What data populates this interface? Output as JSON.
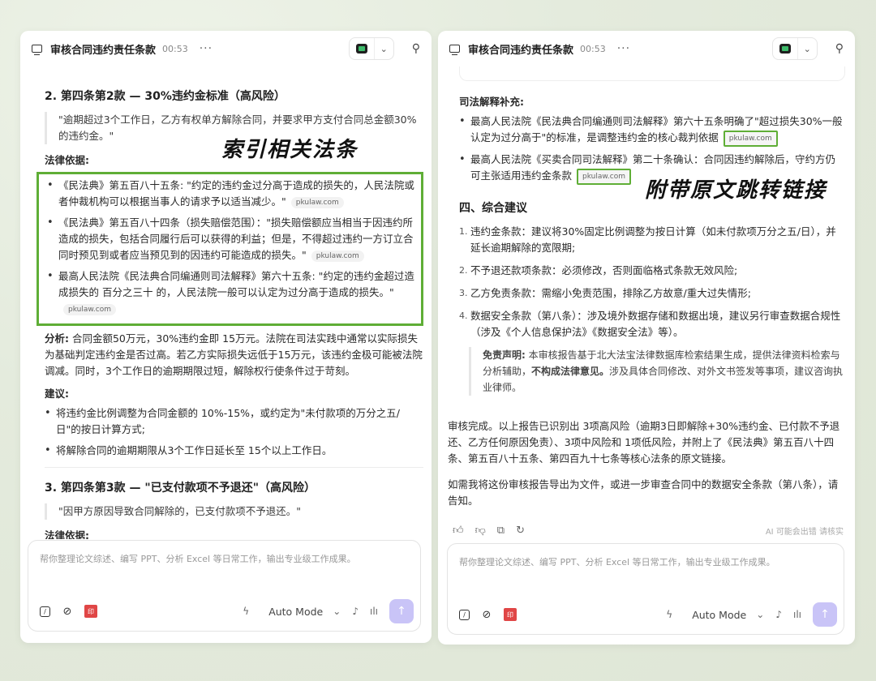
{
  "left": {
    "title": "审核合同违约责任条款",
    "time": "00:53",
    "more": "···",
    "section2": {
      "heading": "2. 第四条第2款 — 30%违约金标准（高风险）",
      "quote": "\"逾期超过3个工作日，乙方有权单方解除合同，并要求甲方支付合同总金额30% 的违约金。\"",
      "legal_label": "法律依据:",
      "legal_items": [
        {
          "text": "《民法典》第五百八十五条: \"约定的违约金过分高于造成的损失的，人民法院或者仲裁机构可以根据当事人的请求予以适当减少。\"",
          "tag": "pkulaw.com"
        },
        {
          "text": "《民法典》第五百八十四条（损失赔偿范围）：\"损失赔偿额应当相当于因违约所造成的损失，包括合同履行后可以获得的利益；但是，不得超过违约一方订立合同时预见到或者应当预见到的因违约可能造成的损失。\"",
          "tag": "pkulaw.com"
        },
        {
          "text": "最高人民法院《民法典合同编通则司法解释》第六十五条: \"约定的违约金超过造成损失的 百分之三十 的，人民法院一般可以认定为过分高于造成的损失。\"",
          "tag": "pkulaw.com"
        }
      ],
      "analysis_label": "分析:",
      "analysis_text": "合同金额50万元，30%违约金即 15万元。法院在司法实践中通常以实际损失为基础判定违约金是否过高。若乙方实际损失远低于15万元，该违约金极可能被法院调减。同时，3个工作日的逾期期限过短，解除权行使条件过于苛刻。",
      "suggest_label": "建议:",
      "suggestions": [
        "将违约金比例调整为合同金额的 10%-15%，或约定为\"未付款项的万分之五/日\"的按日计算方式;",
        "将解除合同的逾期期限从3个工作日延长至 15个以上工作日。"
      ]
    },
    "section3": {
      "heading": "3. 第四条第3款 — \"已支付款项不予退还\"（高风险）",
      "quote": "\"因甲方原因导致合同解除的，已支付款项不予退还。\"",
      "legal_label": "法律依据:"
    },
    "callout": "索引相关法条",
    "composer": {
      "placeholder": "帮你整理论文综述、编写 PPT、分析 Excel 等日常工作，输出专业级工作成果。",
      "mode": "Auto Mode"
    }
  },
  "right": {
    "title": "审核合同违约责任条款",
    "time": "00:53",
    "more": "···",
    "judicial_label": "司法解释补充:",
    "judicial_items": [
      {
        "text": "最高人民法院《民法典合同编通则司法解释》第六十五条明确了\"超过损失30%一般认定为过分高于\"的标准，是调整违约金的核心裁判依据",
        "tag": "pkulaw.com"
      },
      {
        "text": "最高人民法院《买卖合同司法解释》第二十条确认：合同因违约解除后，守约方仍可主张适用违约金条款",
        "tag": "pkulaw.com"
      }
    ],
    "callout": "附带原文跳转链接",
    "section4_heading": "四、综合建议",
    "recommendations": [
      {
        "n": "1.",
        "text": "违约金条款：建议将30%固定比例调整为按日计算（如未付款项万分之五/日），并延长逾期解除的宽限期;"
      },
      {
        "n": "2.",
        "text": "不予退还款项条款：必须修改，否则面临格式条款无效风险;"
      },
      {
        "n": "3.",
        "text": "乙方免责条款：需缩小免责范围，排除乙方故意/重大过失情形;"
      },
      {
        "n": "4.",
        "text": "数据安全条款（第八条）：涉及境外数据存储和数据出境，建议另行审查数据合规性（涉及《个人信息保护法》《数据安全法》等）。"
      }
    ],
    "disclaimer_label": "免责声明:",
    "disclaimer_text": "本审核报告基于北大法宝法律数据库检索结果生成，提供法律资料检索与分析辅助，",
    "disclaimer_bold": "不构成法律意见。",
    "disclaimer_tail": "涉及具体合同修改、对外文书签发等事项，建议咨询执业律师。",
    "summary_p1": "审核完成。以上报告已识别出 3项高风险（逾期3日即解除+30%违约金、已付款不予退还、乙方任何原因免责）、3项中风险和 1项低风险，并附上了《民法典》第五百八十四条、第五百八十五条、第四百九十七条等核心法条的原文链接。",
    "summary_p2": "如需我将这份审核报告导出为文件，或进一步审查合同中的数据安全条款（第八条），请告知。",
    "ai_note": "AI 可能会出错 请核实",
    "composer": {
      "placeholder": "帮你整理论文综述、编写 PPT、分析 Excel 等日常工作，输出专业级工作成果。",
      "mode": "Auto Mode"
    }
  },
  "colors": {
    "highlight_green": "#5fae36",
    "send_button": "#c9c4f7",
    "app_icon_green": "#3dbb6a"
  }
}
